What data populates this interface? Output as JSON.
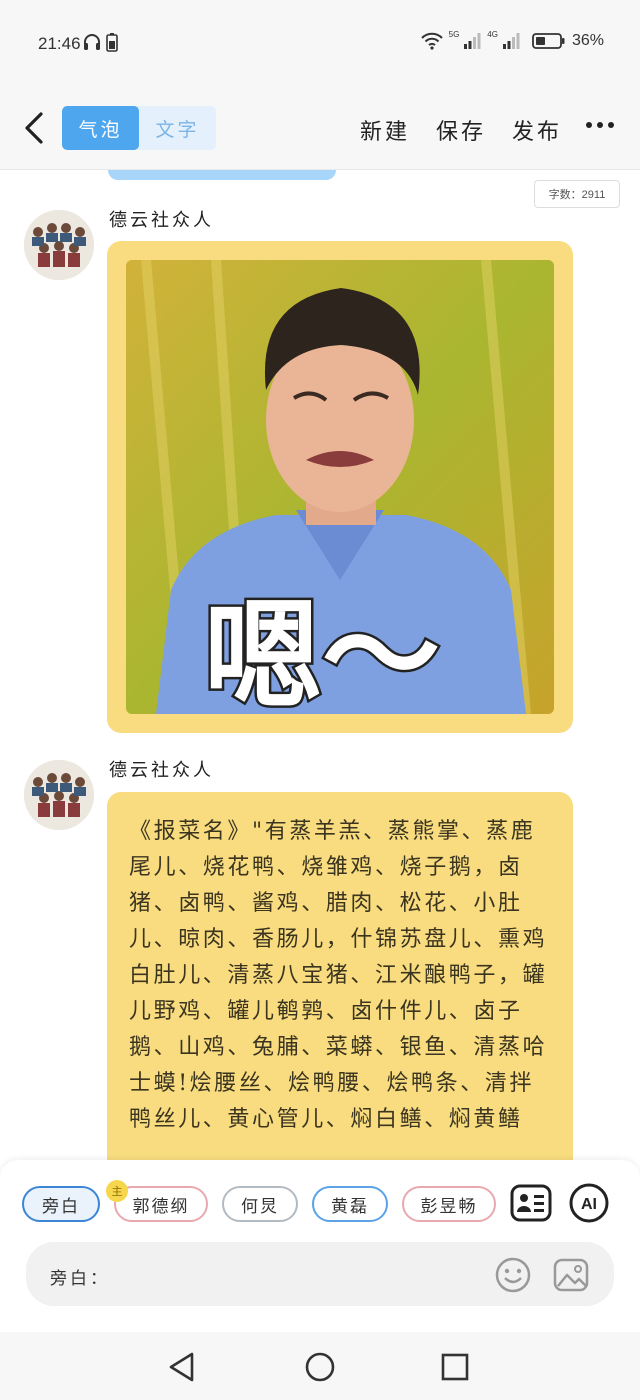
{
  "status_bar": {
    "time": "21:46",
    "network_5g": "5G",
    "network_4g": "4G",
    "battery": "36%"
  },
  "top_bar": {
    "mode_bubble": "气泡",
    "mode_text": "文字",
    "new_label": "新建",
    "save_label": "保存",
    "publish_label": "发布"
  },
  "word_count": "字数：2911",
  "messages": [
    {
      "speaker": "德云社众人",
      "caption": "嗯～",
      "type": "image"
    },
    {
      "speaker": "德云社众人",
      "type": "text",
      "text": "《报菜名》\"有蒸羊羔、蒸熊掌、蒸鹿尾儿、烧花鸭、烧雏鸡、烧子鹅，卤猪、卤鸭、酱鸡、腊肉、松花、小肚儿、晾肉、香肠儿，什锦苏盘儿、熏鸡白肚儿、清蒸八宝猪、江米酿鸭子，罐儿野鸡、罐儿鹌鹑、卤什件儿、卤子鹅、山鸡、兔脯、菜蟒、银鱼、清蒸哈士蟆!烩腰丝、烩鸭腰、烩鸭条、清拌鸭丝儿、黄心管儿、焖白鳝、焖黄鳝"
    }
  ],
  "characters": [
    {
      "name": "旁白"
    },
    {
      "name": "郭德纲",
      "badge": "主"
    },
    {
      "name": "何炅"
    },
    {
      "name": "黄磊"
    },
    {
      "name": "彭昱畅"
    }
  ],
  "input": {
    "label": "旁白：",
    "placeholder": ""
  },
  "colors": {
    "accent": "#4ea6ef",
    "bubble": "#f8dc7f"
  }
}
